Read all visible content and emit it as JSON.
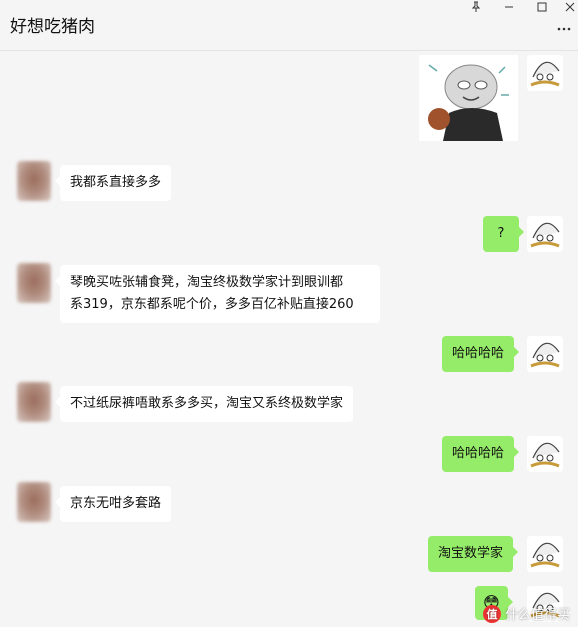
{
  "window": {
    "title": "好想吃猪肉"
  },
  "icons": {
    "pin": "pin-icon",
    "minimize": "minimize-icon",
    "maximize": "maximize-icon",
    "close": "close-icon",
    "more": "more-dots-icon"
  },
  "colors": {
    "background": "#f5f5f5",
    "incoming_bubble": "#ffffff",
    "outgoing_bubble": "#95ec69",
    "text": "#111111"
  },
  "messages": [
    {
      "from": "self",
      "type": "sticker"
    },
    {
      "from": "contact",
      "type": "text",
      "text": "我都系直接多多"
    },
    {
      "from": "self",
      "type": "text",
      "text": "?"
    },
    {
      "from": "contact",
      "type": "text",
      "line1": "琴晚买咗张辅食凳，淘宝终极数学家计到眼训都",
      "line2": "系319，京东都系呢个价，多多百亿补贴直接260"
    },
    {
      "from": "self",
      "type": "text",
      "text": "哈哈哈哈"
    },
    {
      "from": "contact",
      "type": "text",
      "text": "不过纸尿裤唔敢系多多买，淘宝又系终极数学家"
    },
    {
      "from": "self",
      "type": "text",
      "text": "哈哈哈哈"
    },
    {
      "from": "contact",
      "type": "text",
      "text": "京东无咁多套路"
    },
    {
      "from": "self",
      "type": "text",
      "text": "淘宝数学家"
    },
    {
      "from": "self",
      "type": "emoji",
      "text": "😳"
    }
  ],
  "watermark": {
    "logo": "值",
    "text": "什么值得买"
  }
}
